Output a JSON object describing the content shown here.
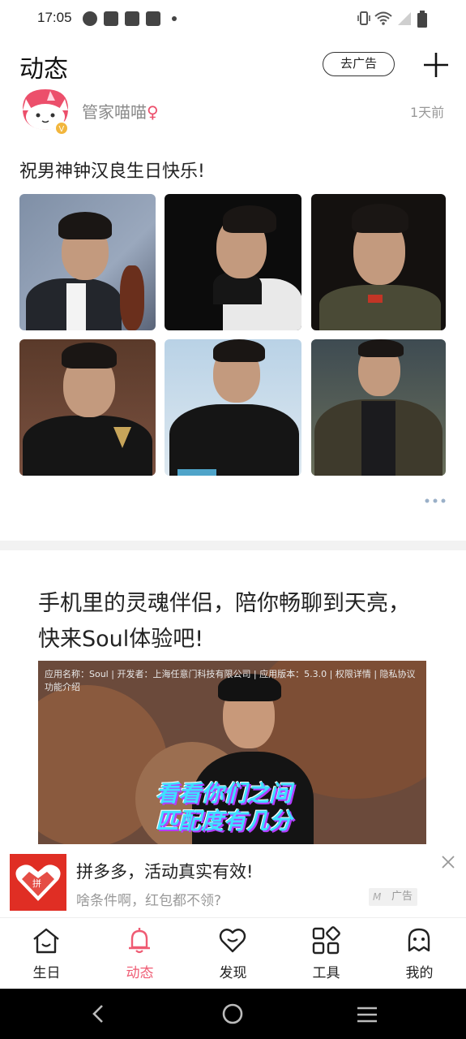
{
  "status_bar": {
    "time": "17:05",
    "icons": [
      "vpn-icon",
      "mail-icon",
      "mail-icon",
      "mail-icon",
      "notification-dot-icon",
      "vibrate-icon",
      "wifi-icon",
      "signal-icon",
      "battery-icon"
    ]
  },
  "header": {
    "title": "动态",
    "ad_button_label": "去广告",
    "add_icon": "plus-icon"
  },
  "post": {
    "username": "管家喵喵",
    "gender_symbol": "♀",
    "time": "1天前",
    "text": "祝男神钟汉良生日快乐!",
    "photo_count": 6
  },
  "ad_post": {
    "title": "手机里的灵魂伴侣，陪你畅聊到天亮，快来Soul体验吧!",
    "video_info": "应用名称：Soul | 开发者：上海任意门科技有限公司 | 应用版本：5.3.0 | 权限详情 | 隐私协议",
    "video_info_2": "功能介绍",
    "caption_line_1": "看看你们之间",
    "caption_line_2": "匹配度有几分"
  },
  "banner": {
    "title": "拼多多，活动真实有效!",
    "subtitle": "啥条件啊，红包都不领?",
    "tag": "广告",
    "brand_color": "#e02e24"
  },
  "bottom_nav": {
    "items": [
      {
        "label": "生日",
        "icon": "birthday-house-icon"
      },
      {
        "label": "动态",
        "icon": "bell-icon"
      },
      {
        "label": "发现",
        "icon": "heart-icon"
      },
      {
        "label": "工具",
        "icon": "grid-icon"
      },
      {
        "label": "我的",
        "icon": "face-icon"
      }
    ],
    "active_index": 1,
    "active_color": "#ef5b73"
  }
}
